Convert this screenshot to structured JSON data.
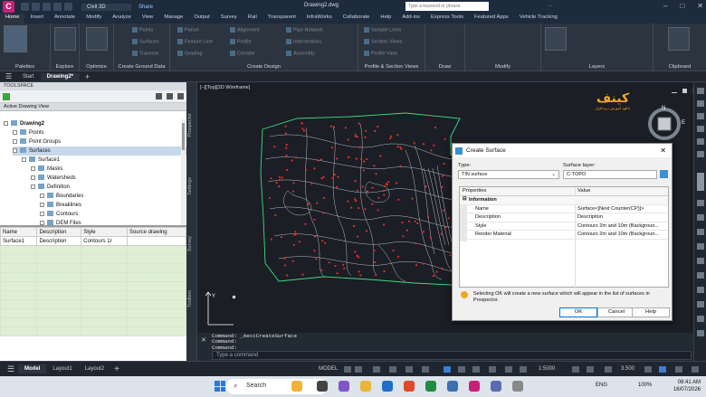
{
  "title_bar": {
    "app_logo": "C",
    "product": "Civil 3D",
    "share": "Share",
    "filename": "Drawing2.dwg",
    "search_placeholder": "Type a keyword or phrase",
    "user": "..."
  },
  "ribbon_tabs": [
    "Home",
    "Insert",
    "Annotate",
    "Modify",
    "Analyze",
    "View",
    "Manage",
    "Output",
    "Survey",
    "Rail",
    "Transparent",
    "InfraWorks",
    "Collaborate",
    "Help",
    "Add-ins",
    "Express Tools",
    "Featured Apps",
    "Vehicle Tracking"
  ],
  "ribbon_groups": [
    {
      "label": "Palettes",
      "items": [
        "Toolspace"
      ]
    },
    {
      "label": "Explore",
      "items": [
        "Project Explorer"
      ]
    },
    {
      "label": "Optimize",
      "items": [
        "Grading Optimization"
      ]
    },
    {
      "label": "Create Ground Data",
      "items": [
        "Points",
        "Surfaces",
        "Traverse"
      ]
    },
    {
      "label": "Create Design",
      "items": [
        "Parcel",
        "Feature Line",
        "Grading",
        "Alignment",
        "Profile",
        "Corridor",
        "Pipe Network",
        "Intersections",
        "Assembly"
      ]
    },
    {
      "label": "Profile & Section Views",
      "items": [
        "Sample Lines",
        "Section Views",
        "Profile View"
      ]
    },
    {
      "label": "Draw",
      "items": []
    },
    {
      "label": "Modify",
      "items": []
    },
    {
      "label": "Layers",
      "items": [
        "Layer Properties"
      ]
    },
    {
      "label": "Clipboard",
      "items": [
        "Paste"
      ]
    }
  ],
  "file_tabs": {
    "start": "Start",
    "active": "Drawing2*"
  },
  "toolspace": {
    "title": "TOOLSPACE",
    "view": "Active Drawing View",
    "tree": [
      {
        "label": "Drawing2",
        "level": 0,
        "bold": true
      },
      {
        "label": "Points",
        "level": 1
      },
      {
        "label": "Point Groups",
        "level": 1
      },
      {
        "label": "Surfaces",
        "level": 1,
        "selected": true
      },
      {
        "label": "Surface1",
        "level": 2
      },
      {
        "label": "Masks",
        "level": 3
      },
      {
        "label": "Watersheds",
        "level": 3
      },
      {
        "label": "Definition",
        "level": 3
      },
      {
        "label": "Boundaries",
        "level": 4
      },
      {
        "label": "Breaklines",
        "level": 4
      },
      {
        "label": "Contours",
        "level": 4
      },
      {
        "label": "DEM Files",
        "level": 4
      }
    ],
    "list_headers": [
      "Name",
      "Description",
      "Style",
      "Source drawing"
    ],
    "list_rows": [
      [
        "Surface1",
        "Description",
        "Contours 1r",
        ""
      ]
    ],
    "side_tabs": [
      "Prospector",
      "Settings",
      "Survey",
      "Toolbox"
    ]
  },
  "viewport": {
    "label": "[−][Top][2D Wireframe]",
    "nav_letter": "N",
    "compass_letter": "E",
    "y_axis": "Y",
    "logo_text": "کینف",
    "logo_sub": "دانلود آموزش نرم افزار"
  },
  "command": {
    "lines": [
      "Command:  _AeccCreateSurface",
      "Command:",
      "Command:"
    ],
    "placeholder": "Type a command"
  },
  "dialog": {
    "title": "Create Surface",
    "type_label": "Type:",
    "type_value": "TIN surface",
    "layer_label": "Surface layer:",
    "layer_value": "C-TOPO",
    "col_properties": "Properties",
    "col_value": "Value",
    "section": "Information",
    "rows": [
      {
        "k": "Name",
        "v": "Surface<[Next Counter(CP)]>"
      },
      {
        "k": "Description",
        "v": "Description"
      },
      {
        "k": "Style",
        "v": "Contours 2m and 10m (Backgroun..."
      },
      {
        "k": "Render Material",
        "v": "Contours 2m and 10m (Backgroun..."
      }
    ],
    "info": "Selecting OK will create a new surface which will appear in the list of surfaces in Prospector.",
    "ok": "OK",
    "cancel": "Cancel",
    "help": "Help"
  },
  "status": {
    "tabs": [
      "Model",
      "Layout1",
      "Layout2"
    ],
    "model": "MODEL",
    "scale": "1:5000",
    "zoom": "3.500"
  },
  "taskbar": {
    "search": "Search",
    "lang": "ENG",
    "volume": "100%",
    "time": "08:41 AM",
    "date": "16/07/2026"
  },
  "colors": {
    "accent": "#c8207a",
    "boundary": "#3ddc84",
    "points": "#e03030",
    "contours": "#cfd6e0"
  }
}
